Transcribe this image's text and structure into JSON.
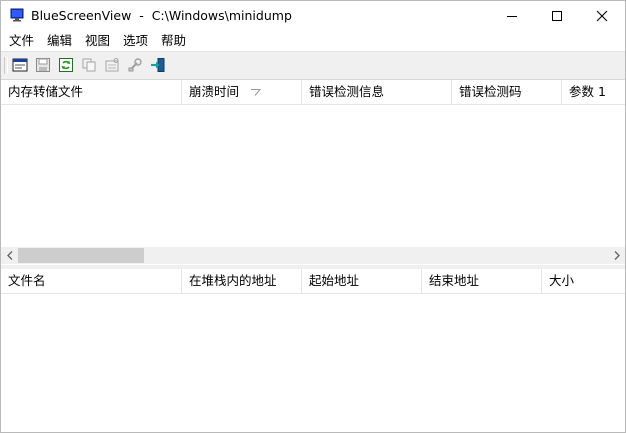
{
  "titlebar": {
    "title": "BlueScreenView  -  C:\\Windows\\minidump",
    "app_icon": "bluescreen-monitor-icon",
    "controls": [
      "minimize-icon",
      "maximize-icon",
      "close-icon"
    ]
  },
  "menu": {
    "items": [
      "文件",
      "编辑",
      "视图",
      "选项",
      "帮助"
    ]
  },
  "toolbar": {
    "buttons": [
      "html-report-icon",
      "save-icon",
      "refresh-icon",
      "copy-icon",
      "properties-icon",
      "advanced-options-icon",
      "exit-icon"
    ]
  },
  "crash_list": {
    "columns": [
      "内存转储文件",
      "崩溃时间",
      "错误检测信息",
      "错误检测码",
      "参数 1"
    ],
    "sorted_column": "崩溃时间",
    "rows": []
  },
  "driver_list": {
    "columns": [
      "文件名",
      "在堆栈内的地址",
      "起始地址",
      "结束地址",
      "大小"
    ],
    "rows": []
  },
  "colors": {
    "toolbar_bg": "#f0f0f0",
    "scrollbar_thumb": "#cdcdcd",
    "header_divider": "#e5e5e5"
  }
}
